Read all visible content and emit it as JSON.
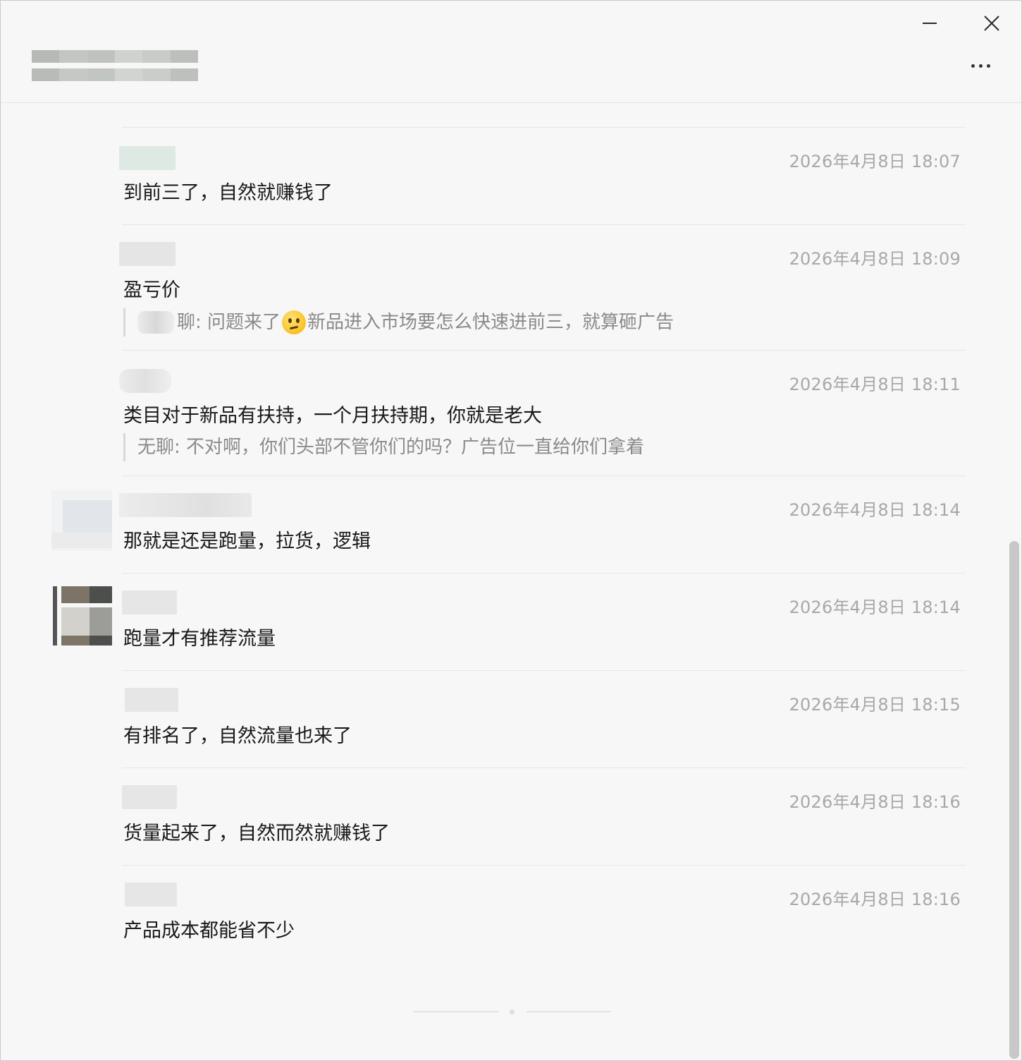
{
  "window": {
    "title_obscured": true,
    "icons": [
      "minimize-icon",
      "close-icon",
      "more-icon"
    ]
  },
  "messages": [
    {
      "time": "2026年4月8日 18:07",
      "text": "到前三了，自然就赚钱了"
    },
    {
      "time": "2026年4月8日 18:09",
      "text": "盈亏价",
      "quote": {
        "prefix": "聊: 问题来了",
        "emoji": "confused-face-emoji",
        "suffix": "新品进入市场要怎么快速进前三，就算砸广告"
      }
    },
    {
      "time": "2026年4月8日 18:11",
      "text": "类目对于新品有扶持，一个月扶持期，你就是老大",
      "quote": {
        "text": "无聊: 不对啊，你们头部不管你们的吗？广告位一直给你们拿着"
      }
    },
    {
      "time": "2026年4月8日 18:14",
      "text": "那就是还是跑量，拉货，逻辑"
    },
    {
      "time": "2026年4月8日 18:14",
      "text": "跑量才有推荐流量"
    },
    {
      "time": "2026年4月8日 18:15",
      "text": "有排名了，自然流量也来了"
    },
    {
      "time": "2026年4月8日 18:16",
      "text": "货量起来了，自然而然就赚钱了"
    },
    {
      "time": "2026年4月8日 18:16",
      "text": "产品成本都能省不少"
    }
  ],
  "colors": {
    "background": "#f7f7f7",
    "divider": "#e6e6e6",
    "timestamp": "#a8a8a8",
    "text": "#181818",
    "quote_text": "#8a8a8a"
  }
}
